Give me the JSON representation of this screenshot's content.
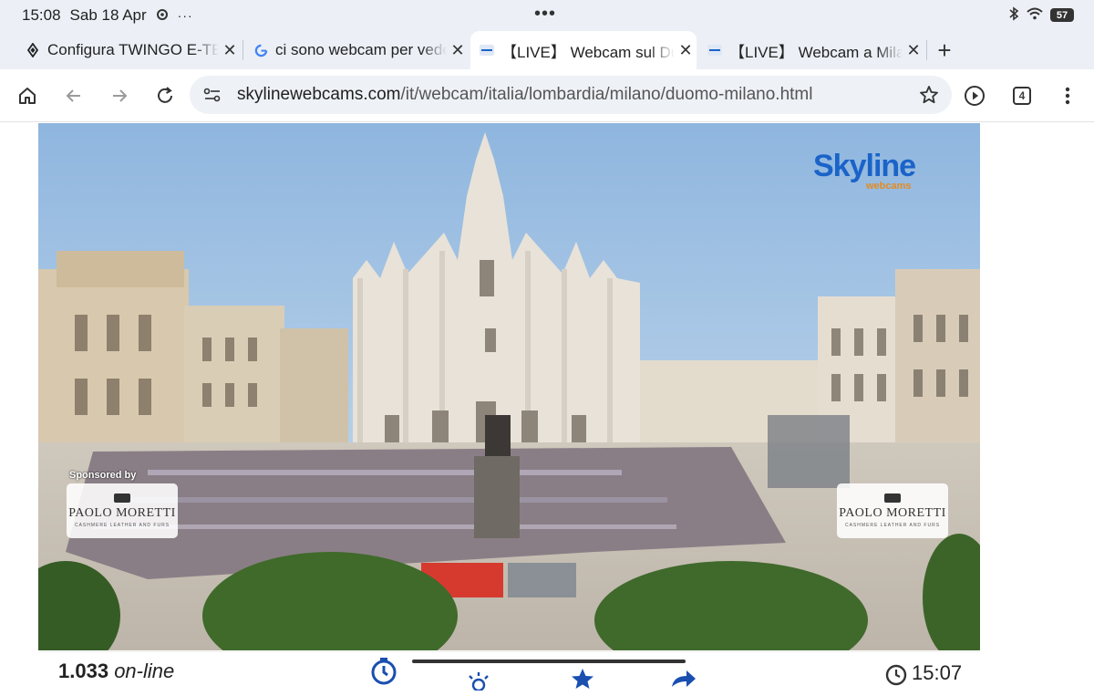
{
  "status": {
    "time": "15:08",
    "date": "Sab 18 Apr",
    "center_dots": "•••",
    "battery": "57"
  },
  "tabs": [
    {
      "title": "Configura TWINGO E-TECH",
      "favicon": "renault-logo-icon",
      "active": false
    },
    {
      "title": "ci sono webcam per vedere",
      "favicon": "google-g-icon",
      "active": false
    },
    {
      "title": "【LIVE】 Webcam sul Duomo",
      "favicon": "skyline-favicon-icon",
      "active": true
    },
    {
      "title": "【LIVE】 Webcam a Milano",
      "favicon": "skyline-favicon-icon",
      "active": false
    }
  ],
  "newtab_label": "+",
  "toolbar": {
    "url_domain": "skylinewebcams.com",
    "url_path": "/it/webcam/italia/lombardia/milano/duomo-milano.html",
    "tab_count": "4"
  },
  "video": {
    "logo_main": "Skyline",
    "logo_sub": "webcams",
    "sponsored_label": "Sponsored by",
    "sponsor_name": "PAOLO MORETTI",
    "sponsor_tagline": "CASHMERE LEATHER AND FURS"
  },
  "infobar": {
    "online_count": "1.033",
    "online_label": "on-line",
    "clock_time": "15:07"
  },
  "colors": {
    "chrome_bg": "#ecf0f6",
    "omnibox_bg": "#eef1f6",
    "accent_blue": "#1a4fb0",
    "logo_blue": "#1a63c8",
    "logo_orange": "#e58a1e"
  }
}
